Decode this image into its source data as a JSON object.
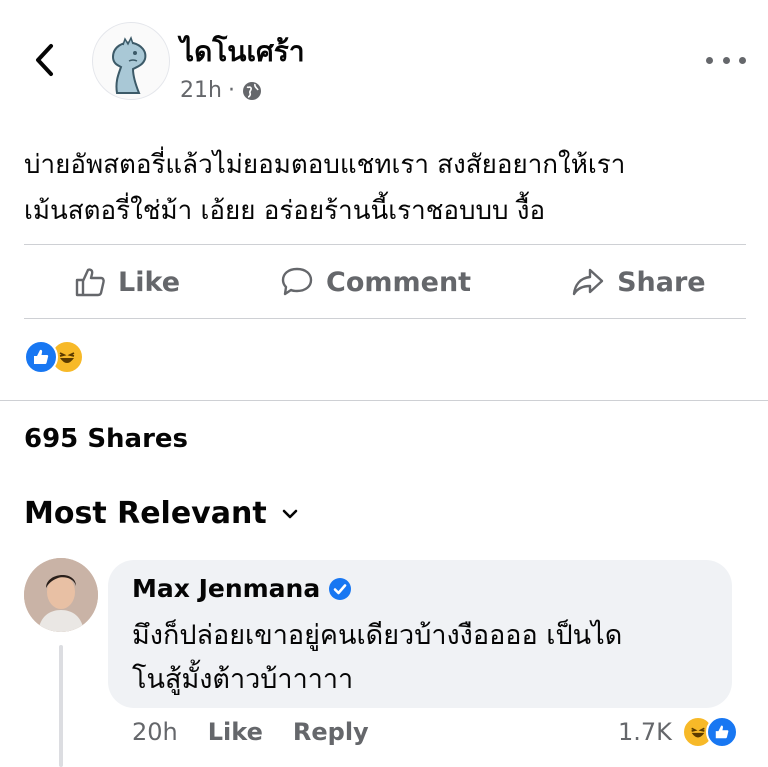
{
  "post": {
    "page_name": "ไดโนเศร้า",
    "time": "21h",
    "separator": "·",
    "text_line1": "บ่ายอัพสตอรี่แล้วไม่ยอมตอบแชทเรา สงสัยอยากให้เรา",
    "text_line2": "เม้นสตอรี่ใช่ม้า เอ้ยย อร่อยร้านนี้เราชอบบบ งื้อ"
  },
  "actions": {
    "like_label": "Like",
    "comment_label": "Comment",
    "share_label": "Share"
  },
  "stats": {
    "shares": "695 Shares"
  },
  "comments_section": {
    "sort_label": "Most Relevant"
  },
  "comment": {
    "author": "Max Jenmana",
    "text_line1": "มึงก็ปล่อยเขาอยู่คนเดียวบ้างงืออออ เป็นได",
    "text_line2": "โนสู้มั้งต้าวบ้าาาาา",
    "time": "20h",
    "like_label": "Like",
    "reply_label": "Reply",
    "reaction_count": "1.7K"
  },
  "colors": {
    "brand_blue": "#1877f2",
    "haha_yellow": "#f7b928",
    "secondary_text": "#65676b",
    "bubble_bg": "#f0f2f5"
  },
  "icons": [
    "chevron-left-icon",
    "globe-icon",
    "more-dots-icon",
    "thumbs-up-icon",
    "speech-bubble-icon",
    "share-arrow-icon",
    "like-reaction-icon",
    "haha-reaction-icon",
    "chevron-down-icon",
    "verified-badge-icon"
  ]
}
